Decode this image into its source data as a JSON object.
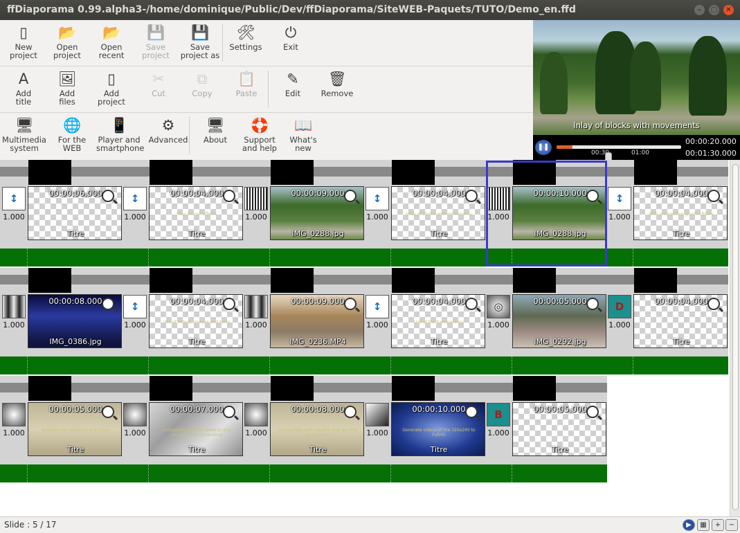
{
  "window": {
    "title": "ffDiaporama 0.99.alpha3-/home/dominique/Public/Dev/ffDiaporama/SiteWEB-Paquets/TUTO/Demo_en.ffd"
  },
  "toolbar": {
    "row1": [
      {
        "l1": "New",
        "l2": "project",
        "icon": "new-project-icon",
        "glyph": "▯",
        "disabled": false
      },
      {
        "l1": "Open",
        "l2": "project",
        "icon": "open-project-icon",
        "glyph": "📂",
        "disabled": false
      },
      {
        "l1": "Open",
        "l2": "recent",
        "icon": "open-recent-icon",
        "glyph": "📂",
        "disabled": false
      },
      {
        "l1": "Save",
        "l2": "project",
        "icon": "save-icon",
        "glyph": "💾",
        "disabled": true
      },
      {
        "l1": "Save",
        "l2": "project as",
        "icon": "save-as-icon",
        "glyph": "💾",
        "disabled": false
      },
      {
        "l1": "Settings",
        "l2": "",
        "icon": "settings-icon",
        "glyph": "🛠",
        "disabled": false
      },
      {
        "l1": "Exit",
        "l2": "",
        "icon": "exit-icon",
        "glyph": "⏻",
        "disabled": false
      }
    ],
    "row2": [
      {
        "l1": "Add",
        "l2": "title",
        "icon": "add-title-icon",
        "glyph": "A",
        "disabled": false
      },
      {
        "l1": "Add",
        "l2": "files",
        "icon": "add-files-icon",
        "glyph": "🖼",
        "disabled": false
      },
      {
        "l1": "Add",
        "l2": "project",
        "icon": "add-project-icon",
        "glyph": "▯",
        "disabled": false
      },
      {
        "l1": "Cut",
        "l2": "",
        "icon": "cut-icon",
        "glyph": "✂",
        "disabled": true
      },
      {
        "l1": "Copy",
        "l2": "",
        "icon": "copy-icon",
        "glyph": "⧉",
        "disabled": true
      },
      {
        "l1": "Paste",
        "l2": "",
        "icon": "paste-icon",
        "glyph": "📋",
        "disabled": true
      },
      {
        "l1": "Edit",
        "l2": "",
        "icon": "edit-icon",
        "glyph": "✎",
        "disabled": false
      },
      {
        "l1": "Remove",
        "l2": "",
        "icon": "remove-icon",
        "glyph": "🗑",
        "disabled": false
      }
    ],
    "row3": [
      {
        "l1": "Multimedia",
        "l2": "system",
        "icon": "monitor-icon",
        "glyph": "🖥",
        "disabled": false
      },
      {
        "l1": "For the",
        "l2": "WEB",
        "icon": "globe-icon",
        "glyph": "🌐",
        "disabled": false
      },
      {
        "l1": "Player and",
        "l2": "smartphone",
        "icon": "smartphone-icon",
        "glyph": "📱",
        "disabled": false
      },
      {
        "l1": "Advanced",
        "l2": "",
        "icon": "gear-icon",
        "glyph": "⚙",
        "disabled": false
      },
      {
        "l1": "About",
        "l2": "",
        "icon": "about-icon",
        "glyph": "🖥",
        "disabled": false
      },
      {
        "l1": "Support",
        "l2": "and help",
        "icon": "lifebuoy-icon",
        "glyph": "🛟",
        "disabled": false
      },
      {
        "l1": "What's new",
        "l2": "",
        "icon": "book-icon",
        "glyph": "📖",
        "disabled": false
      }
    ]
  },
  "preview": {
    "caption": "Inlay of blocks with movements",
    "current_time": "00:00:20.000",
    "total_time": "00:01:30.000",
    "tick1": "00:30",
    "tick2": "01:00",
    "progress_fraction": 0.22
  },
  "rows": [
    {
      "slides": [
        {
          "trans": "tr-arrows",
          "tglyph": "↕",
          "tdur": "1.000",
          "dur": "00:00:06.000",
          "name": "Titre",
          "text": "",
          "bg": ""
        },
        {
          "trans": "tr-arrows",
          "tglyph": "↕",
          "tdur": "1.000",
          "dur": "00:00:04.000",
          "name": "Titre",
          "text": "\"Ken Burns\" effects",
          "bg": ""
        },
        {
          "trans": "tr-stripes",
          "tglyph": "",
          "tdur": "1.000",
          "dur": "00:00:09.000",
          "name": "IMG_0288.jpg",
          "text": "",
          "bg": "park"
        },
        {
          "trans": "tr-arrows",
          "tglyph": "↕",
          "tdur": "1.000",
          "dur": "00:00:04.000",
          "name": "Titre",
          "text": "Inlay of blocks with movements",
          "bg": ""
        },
        {
          "trans": "tr-grid",
          "tglyph": "",
          "tdur": "1.000",
          "dur": "00:00:10.000",
          "name": "IMG_0288.jpg",
          "text": "",
          "bg": "park"
        },
        {
          "trans": "tr-arrows",
          "tglyph": "↕",
          "tdur": "1.000",
          "dur": "00:00:04.000",
          "name": "Titre",
          "text": "With progressive graphic filters",
          "bg": ""
        }
      ]
    },
    {
      "slides": [
        {
          "trans": "tr-bars",
          "tglyph": "",
          "tdur": "1.000",
          "dur": "00:00:08.000",
          "name": "IMG_0386.jpg",
          "text": "",
          "bg": "church"
        },
        {
          "trans": "tr-arrows",
          "tglyph": "↕",
          "tdur": "1.000",
          "dur": "00:00:04.000",
          "name": "Titre",
          "text": "Use of videos, images and texts",
          "bg": ""
        },
        {
          "trans": "tr-bars",
          "tglyph": "",
          "tdur": "1.000",
          "dur": "00:00:09.000",
          "name": "IMG_0236.MP4",
          "text": "",
          "bg": "street"
        },
        {
          "trans": "tr-arrows",
          "tglyph": "↕",
          "tdur": "1.000",
          "dur": "00:00:04.000",
          "name": "Titre",
          "text": "Use of the transparency",
          "bg": ""
        },
        {
          "trans": "tr-spiral",
          "tglyph": "◎",
          "tdur": "1.000",
          "dur": "00:00:05.000",
          "name": "IMG_0292.jpg",
          "text": "",
          "bg": "shop"
        },
        {
          "trans": "tr-d",
          "tglyph": "D",
          "tdur": "1.000",
          "dur": "00:00:04.000",
          "name": "Titre",
          "text": "",
          "bg": ""
        }
      ]
    },
    {
      "slides": [
        {
          "trans": "tr-gradient",
          "tglyph": "",
          "tdur": "1.000",
          "dur": "00:00:05.000",
          "name": "Titre",
          "text": "Available for Windows and Linux",
          "bg": "sand"
        },
        {
          "trans": "tr-gradient",
          "tglyph": "",
          "tdur": "1.000",
          "dur": "00:00:07.000",
          "name": "Titre",
          "text": "Compatible with all cameras and smartphones generating",
          "bg": "paper"
        },
        {
          "trans": "tr-gradient",
          "tglyph": "",
          "tdur": "1.000",
          "dur": "00:00:08.000",
          "name": "Titre",
          "text": "Compatible with capable that we find on internet",
          "bg": "sand"
        },
        {
          "trans": "tr-diag",
          "tglyph": "",
          "tdur": "1.000",
          "dur": "00:00:10.000",
          "name": "Titre",
          "text": "Generate videos of the 320x240 to FullHD",
          "bg": "blue"
        },
        {
          "trans": "tr-b",
          "tglyph": "B",
          "tdur": "1.000",
          "dur": "00:00:05.000",
          "name": "Titre",
          "text": "",
          "bg": ""
        }
      ]
    }
  ],
  "status": {
    "slide_info": "Slide : 5 / 17"
  }
}
